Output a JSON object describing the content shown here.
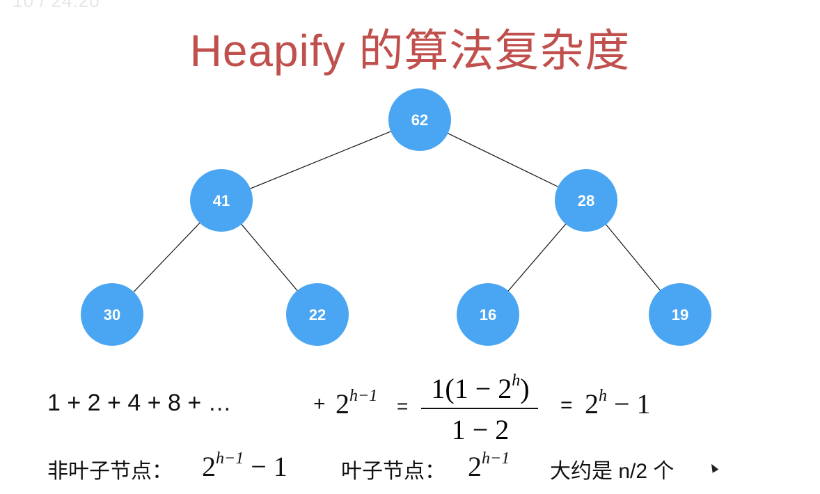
{
  "header": {
    "timestamp": "10 / 24:20",
    "title": "Heapify 的算法复杂度"
  },
  "tree": {
    "node_color": "#4aa6f2",
    "nodes": [
      {
        "id": "root",
        "label": "62",
        "level": 0,
        "index": 0
      },
      {
        "id": "l1-left",
        "label": "41",
        "level": 1,
        "index": 0
      },
      {
        "id": "l1-right",
        "label": "28",
        "level": 1,
        "index": 1
      },
      {
        "id": "l2-a",
        "label": "30",
        "level": 2,
        "index": 0
      },
      {
        "id": "l2-b",
        "label": "22",
        "level": 2,
        "index": 1
      },
      {
        "id": "l2-c",
        "label": "16",
        "level": 2,
        "index": 2
      },
      {
        "id": "l2-d",
        "label": "19",
        "level": 2,
        "index": 3
      }
    ],
    "edges": [
      [
        "root",
        "l1-left"
      ],
      [
        "root",
        "l1-right"
      ],
      [
        "l1-left",
        "l2-a"
      ],
      [
        "l1-left",
        "l2-b"
      ],
      [
        "l1-right",
        "l2-c"
      ],
      [
        "l1-right",
        "l2-d"
      ]
    ]
  },
  "formula": {
    "series": "1 + 2 + 4  + 8 + …",
    "plus": "+",
    "two_base": "2",
    "exp_h_minus_1": "h−1",
    "equals": "=",
    "frac_numerator_pre": "1(1 − 2",
    "frac_numerator_exp": "h",
    "frac_numerator_post": ")",
    "frac_denominator": "1 − 2",
    "result_equals": "=",
    "result_base": "2",
    "result_exp": "h",
    "result_tail": " − 1"
  },
  "summary": {
    "non_leaf_label": "非叶子节点：",
    "non_leaf_base": "2",
    "non_leaf_exp": "h−1",
    "non_leaf_tail": " − 1",
    "leaf_label": "叶子节点：",
    "leaf_base": "2",
    "leaf_exp": "h−1",
    "approx_text": "大约是 n/2 个"
  }
}
